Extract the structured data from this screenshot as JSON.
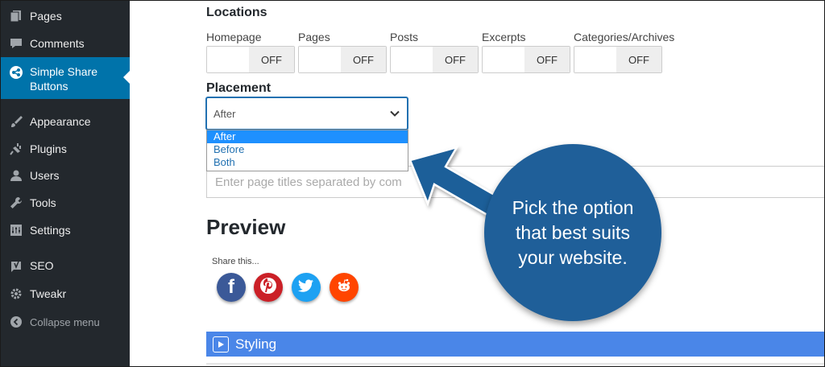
{
  "sidebar": {
    "items": [
      {
        "label": "Pages",
        "icon": "pages-icon"
      },
      {
        "label": "Comments",
        "icon": "comments-icon"
      },
      {
        "label": "Simple Share Buttons",
        "icon": "share-icon",
        "active": true
      },
      {
        "label": "Appearance",
        "icon": "paintbrush-icon"
      },
      {
        "label": "Plugins",
        "icon": "plugin-icon"
      },
      {
        "label": "Users",
        "icon": "users-icon"
      },
      {
        "label": "Tools",
        "icon": "wrench-icon"
      },
      {
        "label": "Settings",
        "icon": "settings-icon"
      },
      {
        "label": "SEO",
        "icon": "seo-icon"
      },
      {
        "label": "Tweakr",
        "icon": "gear-icon"
      },
      {
        "label": "Collapse menu",
        "icon": "collapse-icon"
      }
    ]
  },
  "locations": {
    "heading": "Locations",
    "items": [
      {
        "label": "Homepage",
        "state": "OFF"
      },
      {
        "label": "Pages",
        "state": "OFF"
      },
      {
        "label": "Posts",
        "state": "OFF"
      },
      {
        "label": "Excerpts",
        "state": "OFF"
      },
      {
        "label": "Categories/Archives",
        "state": "OFF"
      }
    ]
  },
  "placement": {
    "heading": "Placement",
    "selected": "After",
    "options": [
      "After",
      "Before",
      "Both"
    ]
  },
  "exclude_pages": {
    "placeholder": "Enter page titles separated by com"
  },
  "preview": {
    "heading": "Preview",
    "share_text": "Share this...",
    "buttons": [
      {
        "name": "facebook",
        "color": "#3b5998",
        "glyph": "f"
      },
      {
        "name": "pinterest",
        "color": "#cb2027",
        "glyph": "P"
      },
      {
        "name": "twitter",
        "color": "#1da1f2",
        "glyph": "t"
      },
      {
        "name": "reddit",
        "color": "#ff4500",
        "glyph": "r"
      }
    ]
  },
  "styling": {
    "label": "Styling"
  },
  "callout": {
    "text": "Pick the option that best suits your website."
  },
  "colors": {
    "sidebar": "#23282d",
    "active": "#0073aa",
    "styling_bar": "#4a86e8",
    "callout": "#1f5f99"
  }
}
